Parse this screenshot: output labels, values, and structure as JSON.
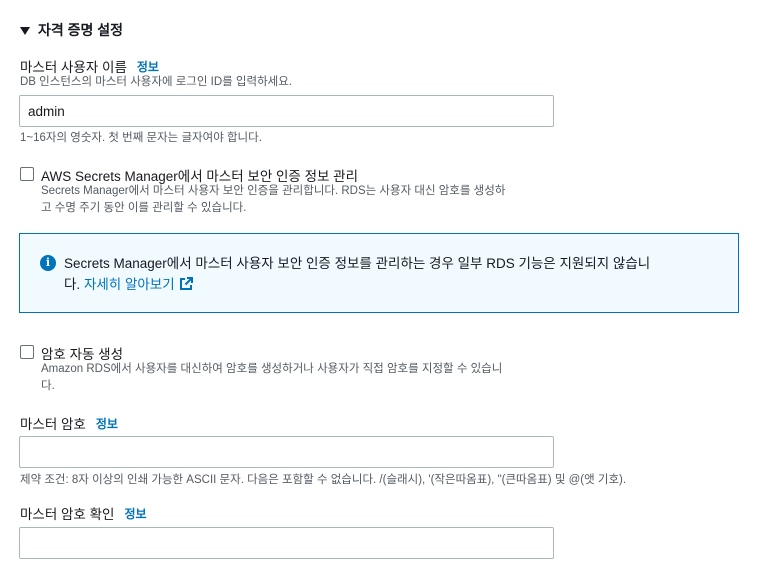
{
  "section": {
    "title": "자격 증명 설정"
  },
  "master_username": {
    "label": "마스터 사용자 이름",
    "info": "정보",
    "description": "DB 인스턴스의 마스터 사용자에 로그인 ID를 입력하세요.",
    "value": "admin",
    "constraint": "1~16자의 영숫자. 첫 번째 문자는 글자여야 합니다."
  },
  "secrets_manager": {
    "checked": false,
    "label": "AWS Secrets Manager에서 마스터 보안 인증 정보 관리",
    "description_line1": "Secrets Manager에서 마스터 사용자 보안 인증을 관리합니다. RDS는 사용자 대신 암호를 생성하",
    "description_line2": "고 수명 주기 동안 이를 관리할 수 있습니다."
  },
  "alert": {
    "text_line1": "Secrets Manager에서 마스터 사용자 보안 인증 정보를 관리하는 경우 일부 RDS 기능은 지원되지 않습니",
    "text_line2_prefix": "다.",
    "link": "자세히 알아보기",
    "icon": "info-icon",
    "color": "#0073bb",
    "background": "#f1faff"
  },
  "auto_password": {
    "checked": false,
    "label": "암호 자동 생성",
    "description_line1": "Amazon RDS에서 사용자를 대신하여 암호를 생성하거나 사용자가 직접 암호를 지정할 수 있습니",
    "description_line2": "다."
  },
  "master_password": {
    "label": "마스터 암호",
    "info": "정보",
    "value": "",
    "constraint": "제약 조건: 8자 이상의 인쇄 가능한 ASCII 문자. 다음은 포함할 수 없습니다. /(슬래시), '(작은따옴표), \"(큰따옴표) 및 @(앳 기호)."
  },
  "confirm_password": {
    "label": "마스터 암호 확인",
    "info": "정보",
    "value": ""
  }
}
